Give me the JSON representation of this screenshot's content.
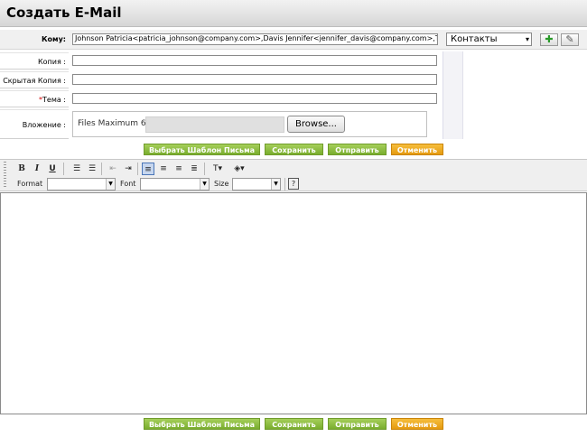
{
  "page": {
    "title": "Создать E-Mail"
  },
  "form": {
    "to_label": "Кому:",
    "to_value": "Johnson Patricia<patricia_johnson@company.com>,Davis Jennifer<jennifer_davis@company.com>,Тайлер",
    "cc_label": "Копия :",
    "bcc_label": "Скрытая Копия :",
    "subject_required": "*",
    "subject_label": "Тема :",
    "attachment_label": "Вложение :",
    "attachment_hint": "Files Maximum 6",
    "browse_label": "Browse...",
    "contacts_select": "Контакты"
  },
  "icons": {
    "add": "plus-icon",
    "clear": "eraser-icon"
  },
  "actions": {
    "template": "Выбрать Шаблон Письма",
    "save": "Сохранить",
    "send": "Отправить",
    "cancel": "Отменить"
  },
  "toolbar": {
    "bold": "B",
    "italic": "I",
    "underline": "U",
    "format_label": "Format",
    "font_label": "Font",
    "size_label": "Size",
    "help": "?"
  },
  "colors": {
    "green_button": "#79ad2e",
    "orange_button": "#e59a10",
    "active_tool": "#c6d6ee"
  }
}
